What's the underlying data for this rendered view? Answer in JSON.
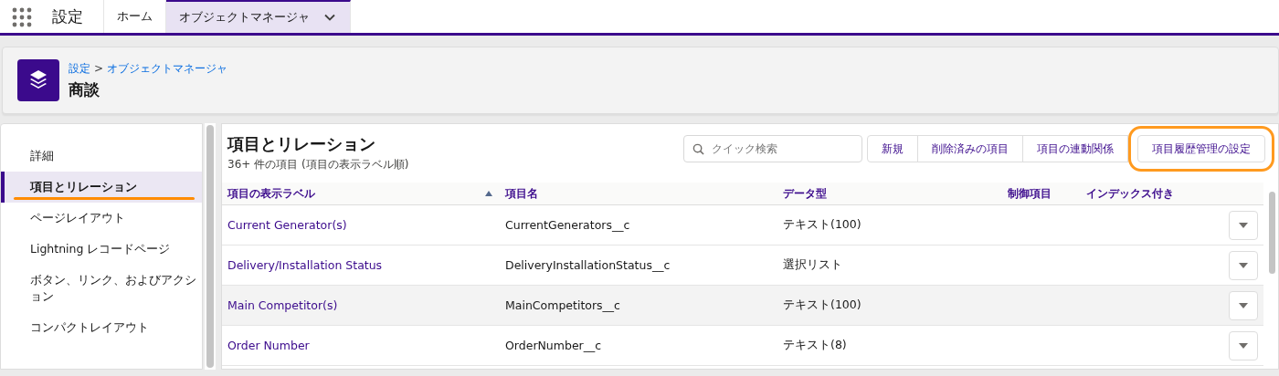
{
  "app_title": "設定",
  "tabs": [
    {
      "label": "ホーム",
      "selected": false,
      "has_menu": false
    },
    {
      "label": "オブジェクトマネージャ",
      "selected": true,
      "has_menu": true
    }
  ],
  "header": {
    "breadcrumb": [
      {
        "label": "設定"
      },
      {
        "label": "オブジェクトマネージャ"
      }
    ],
    "separator": ">",
    "title": "商談"
  },
  "sidebar": {
    "items": [
      {
        "label": "詳細",
        "selected": false,
        "highlighted": false
      },
      {
        "label": "項目とリレーション",
        "selected": true,
        "highlighted": true
      },
      {
        "label": "ページレイアウト",
        "selected": false,
        "highlighted": false
      },
      {
        "label": "Lightning レコードページ",
        "selected": false,
        "highlighted": false
      },
      {
        "label": "ボタン、リンク、およびアクション",
        "selected": false,
        "highlighted": false
      },
      {
        "label": "コンパクトレイアウト",
        "selected": false,
        "highlighted": false
      }
    ]
  },
  "panel": {
    "title": "項目とリレーション",
    "subtitle": "36+ 件の項目 (項目の表示ラベル順)",
    "search": {
      "placeholder": "クイック検索"
    },
    "buttons": [
      {
        "label": "新規",
        "highlighted": false
      },
      {
        "label": "削除済みの項目",
        "highlighted": false
      },
      {
        "label": "項目の連動関係",
        "highlighted": false
      },
      {
        "label": "項目履歴管理の設定",
        "highlighted": true
      }
    ]
  },
  "table": {
    "columns": [
      {
        "label": "項目の表示ラベル",
        "sorted": true
      },
      {
        "label": "項目名",
        "sorted": false
      },
      {
        "label": "データ型",
        "sorted": false
      },
      {
        "label": "制御項目",
        "sorted": false
      },
      {
        "label": "インデックス付き",
        "sorted": false
      }
    ],
    "rows": [
      {
        "label": "Current Generator(s)",
        "name": "CurrentGenerators__c",
        "type": "テキスト(100)",
        "hovered": false
      },
      {
        "label": "Delivery/Installation Status",
        "name": "DeliveryInstallationStatus__c",
        "type": "選択リスト",
        "hovered": false
      },
      {
        "label": "Main Competitor(s)",
        "name": "MainCompetitors__c",
        "type": "テキスト(100)",
        "hovered": true
      },
      {
        "label": "Order Number",
        "name": "OrderNumber__c",
        "type": "テキスト(8)",
        "hovered": false
      }
    ]
  }
}
